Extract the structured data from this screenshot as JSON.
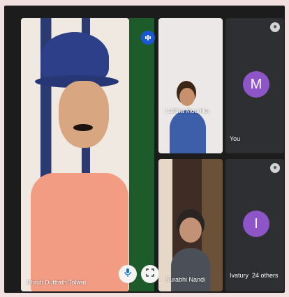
{
  "participants": {
    "main": {
      "name": "Shruti Dutttath Tolwat"
    },
    "top_middle": {
      "name": "Lalitha Mounika"
    },
    "top_right": {
      "name": "You",
      "avatar_letter": "M"
    },
    "bottom_middle": {
      "name": "Surabhi Nandi"
    },
    "bottom_right": {
      "name": "Ivatury",
      "avatar_letter": "I",
      "others": "24 others"
    }
  },
  "colors": {
    "avatar": "#8e55c8",
    "active_speaker": "#1c57d9"
  }
}
